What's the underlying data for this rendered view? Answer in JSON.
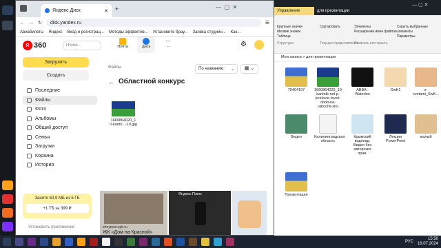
{
  "browser": {
    "tab_title": "Яндекс Диск",
    "url": "disk.yandex.ru",
    "bookmarks": [
      "Авиабилеты",
      "Яндекс",
      "Вход и регистрац...",
      "Методы эффектив...",
      "Установите брау...",
      "Заявка студийн...",
      "Как..."
    ],
    "logo_text": "360",
    "search_placeholder": "Поиск...",
    "header_tabs": [
      "Почта",
      "Диск",
      "..."
    ],
    "sidebar": {
      "upload": "Загрузить",
      "create": "Создать",
      "items": [
        "Последние",
        "Файлы",
        "Фото",
        "Альбомы",
        "Общий доступ",
        "Семья",
        "Загрузки",
        "Корзина",
        "История"
      ]
    },
    "breadcrumb": "Файлы",
    "folder_title": "Областной конкурс",
    "sort_label": "По названию",
    "file": {
      "name": "1660864020_1 0-kartin...-10.jpg"
    },
    "promo": {
      "text": "Занято 60,9 МБ из 5 ГБ",
      "button": "+1 ТБ за 399 ₽"
    },
    "install_app": "Установить приложение",
    "ads": [
      {
        "source": "stroytrest.spb.ru",
        "title": "ЖК «Дом на Красной»"
      },
      {
        "source": "Яндекс Плюс",
        "title": ""
      },
      {
        "source": "",
        "title": ""
      }
    ]
  },
  "explorer": {
    "tabs": [
      "Управление",
      "для презентации"
    ],
    "ribbon_items": [
      "Крупные значки",
      "Мелкие значки",
      "Таблица",
      "Сортировать",
      "Элементы",
      "Расширения имен файлов",
      "Скрыть выбранные элементы",
      "Параметры"
    ],
    "ribbon_groups": [
      "Структура",
      "Текущее представление",
      "Показать или скрыть"
    ],
    "breadcrumb": "Мои записи > для презентации",
    "files": [
      {
        "name": "79404197"
      },
      {
        "name": "1660864020_10-kartinki-net-p-pcelovie-tsveti-obob-na-rabochii-stol"
      },
      {
        "name": "ABBA - Waterloo"
      },
      {
        "name": "GwK1"
      },
      {
        "name": "s-cvetami_SwK..."
      },
      {
        "name": "Видео"
      },
      {
        "name": "Калининградская область"
      },
      {
        "name": "Крымский водопад. Видео без авторских прав."
      },
      {
        "name": "Лекции PowerPoint"
      },
      {
        "name": "малый"
      },
      {
        "name": "Презентация"
      }
    ]
  },
  "taskbar": {
    "time": "15:50",
    "date": "18.07.2024",
    "lang": "РУС"
  }
}
